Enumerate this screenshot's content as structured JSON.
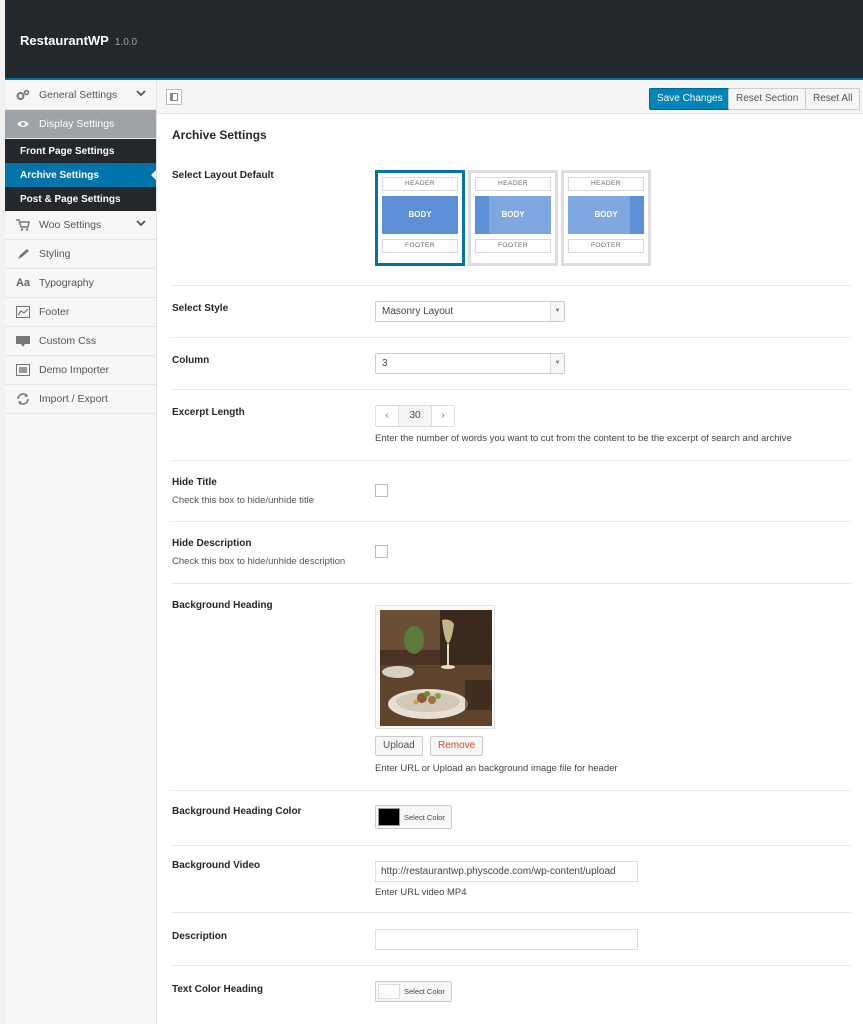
{
  "app": {
    "name": "RestaurantWP",
    "version": "1.0.0"
  },
  "sidebar": {
    "items": [
      {
        "label": "General Settings",
        "icon": "gears-icon"
      },
      {
        "label": "Display Settings",
        "icon": "eye-icon"
      },
      {
        "label": "Woo Settings",
        "icon": "cart-icon"
      },
      {
        "label": "Styling",
        "icon": "brush-icon"
      },
      {
        "label": "Typography",
        "icon": "typography-icon",
        "glyph": "Aa"
      },
      {
        "label": "Footer",
        "icon": "footer-chart-icon"
      },
      {
        "label": "Custom Css",
        "icon": "css-icon"
      },
      {
        "label": "Demo Importer",
        "icon": "importer-icon"
      },
      {
        "label": "Import / Export",
        "icon": "refresh-icon"
      }
    ],
    "subitems": [
      {
        "label": "Front Page Settings"
      },
      {
        "label": "Archive Settings"
      },
      {
        "label": "Post & Page Settings"
      }
    ]
  },
  "toolbar": {
    "save": "Save Changes",
    "reset_section": "Reset Section",
    "reset_all": "Reset All"
  },
  "main": {
    "title": "Archive Settings",
    "layout": {
      "label": "Select Layout Default",
      "header": "HEADER",
      "body": "BODY",
      "footer": "FOOTER",
      "selected_index": 0
    },
    "style": {
      "label": "Select Style",
      "value": "Masonry Layout"
    },
    "column": {
      "label": "Column",
      "value": "3"
    },
    "excerpt": {
      "label": "Excerpt Length",
      "value": "30",
      "prev": "‹",
      "next": "›",
      "desc": "Enter the number of words you want to cut from the content to be the excerpt of search and archive"
    },
    "hide_title": {
      "label": "Hide Title",
      "desc": "Check this box to hide/unhide title",
      "checked": false
    },
    "hide_description": {
      "label": "Hide Description",
      "desc": "Check this box to hide/unhide description",
      "checked": false
    },
    "background_heading": {
      "label": "Background Heading",
      "upload": "Upload",
      "remove": "Remove",
      "desc": "Enter URL or Upload an background image file for header"
    },
    "background_heading_color": {
      "label": "Background Heading Color",
      "button": "Select Color",
      "color": "#000000"
    },
    "background_video": {
      "label": "Background Video",
      "value": "http://restaurantwp.physcode.com/wp-content/upload",
      "desc": "Enter URL video MP4"
    },
    "description": {
      "label": "Description",
      "value": ""
    },
    "text_color_heading": {
      "label": "Text Color Heading",
      "button": "Select Color",
      "color": "#ffffff"
    }
  }
}
